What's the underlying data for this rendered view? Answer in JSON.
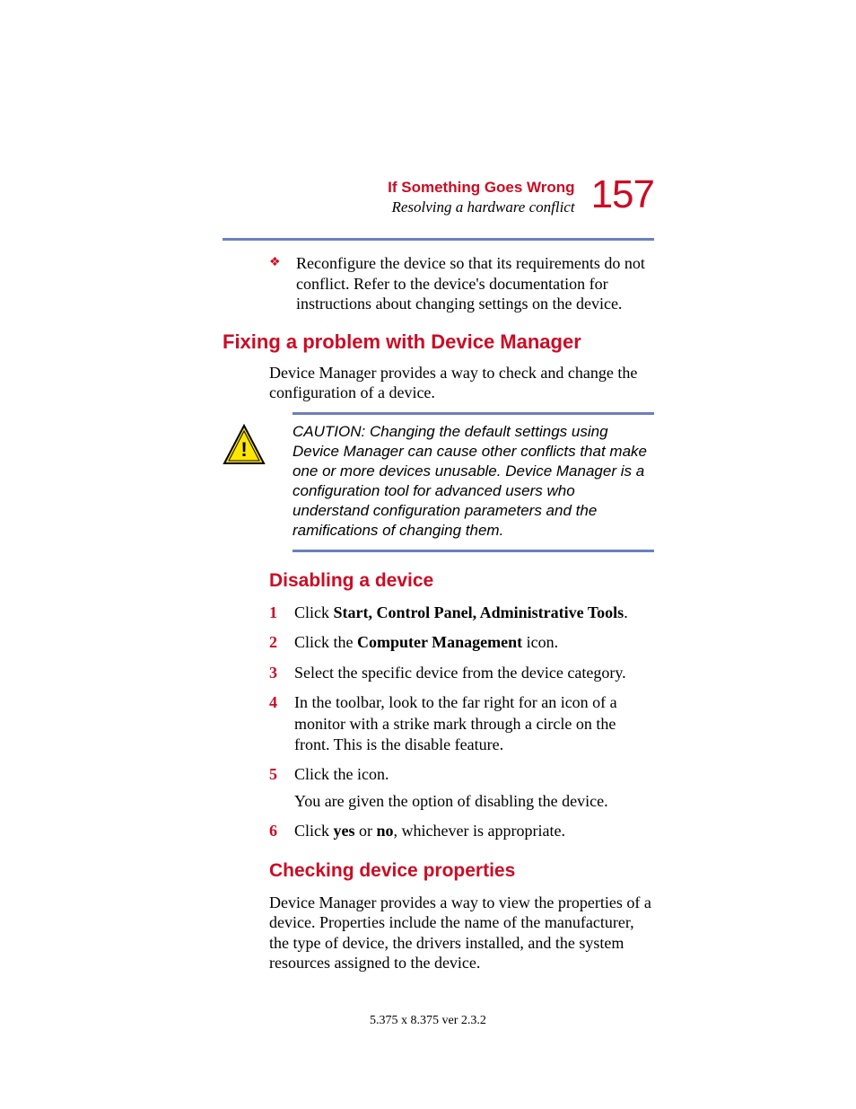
{
  "header": {
    "title": "If Something Goes Wrong",
    "subtitle": "Resolving a hardware conflict",
    "page_number": "157"
  },
  "intro_bullet": "Reconfigure the device so that its requirements do not conflict. Refer to the device's documentation for instructions about changing settings on the device.",
  "section1": {
    "heading": "Fixing a problem with Device Manager",
    "body": "Device Manager provides a way to check and change the configuration of a device."
  },
  "caution": {
    "text": "CAUTION: Changing the default settings using Device Manager can cause other conflicts that make one or more devices unusable. Device Manager is a configuration tool for advanced users who understand configuration parameters and the ramifications of changing them."
  },
  "section2": {
    "heading": "Disabling a device",
    "steps": [
      {
        "pre": "Click ",
        "bold": "Start, Control Panel, Administrative Tools",
        "post": "."
      },
      {
        "pre": "Click the ",
        "bold": "Computer Management",
        "post": " icon."
      },
      {
        "plain": "Select the specific device from the device category."
      },
      {
        "plain": "In the toolbar, look to the far right for an icon of a monitor with a strike mark through a circle on the front. This is the disable feature."
      },
      {
        "plain": "Click the icon.",
        "sub": "You are given the option of disabling the device."
      },
      {
        "pre": "Click ",
        "bold": "yes",
        "mid": " or ",
        "bold2": "no",
        "post": ", whichever is appropriate."
      }
    ]
  },
  "section3": {
    "heading": "Checking device properties",
    "body": "Device Manager provides a way to view the properties of a device. Properties include the name of the manufacturer, the type of device, the drivers installed, and the system resources assigned to the device."
  },
  "footer": "5.375 x 8.375 ver 2.3.2"
}
